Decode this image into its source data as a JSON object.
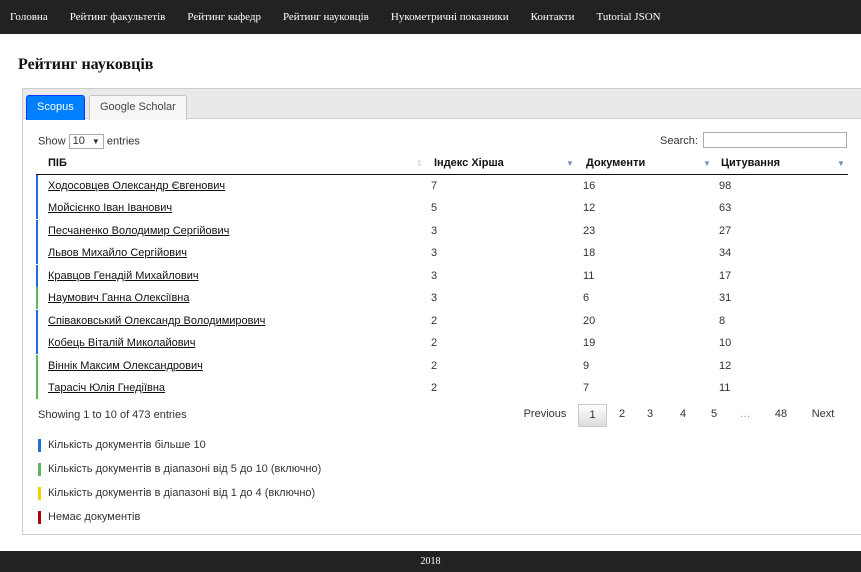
{
  "nav": [
    "Головна",
    "Рейтинг факультетів",
    "Рейтинг кафедр",
    "Рейтинг науковців",
    "Нукометричні показники",
    "Контакти",
    "Tutorial JSON"
  ],
  "page_title": "Рейтинг науковців",
  "tabs": [
    {
      "label": "Scopus",
      "active": true
    },
    {
      "label": "Google Scholar",
      "active": false
    }
  ],
  "table_controls": {
    "show_label": "Show",
    "entries_value": "10",
    "entries_label": "entries",
    "search_label": "Search:",
    "search_value": ""
  },
  "columns": [
    "ПІБ",
    "Індекс Хірша",
    "Документи",
    "Цитування"
  ],
  "colors": {
    "more_than_10": "#1f6fd6",
    "range_5_10": "#5cb85c",
    "range_1_4": "#f0d000",
    "none": "#b0000e",
    "active_tab": "#007fff",
    "navbar": "#222222"
  },
  "rows": [
    {
      "name": "Ходосовцев Олександр Євгенович",
      "h_index": "7",
      "documents": "16",
      "citations": "98",
      "category": "more_than_10"
    },
    {
      "name": "Мойсієнко Іван Іванович",
      "h_index": "5",
      "documents": "12",
      "citations": "63",
      "category": "more_than_10"
    },
    {
      "name": "Песчаненко Володимир Сергійович",
      "h_index": "3",
      "documents": "23",
      "citations": "27",
      "category": "more_than_10"
    },
    {
      "name": "Львов Михайло Сергійович",
      "h_index": "3",
      "documents": "18",
      "citations": "34",
      "category": "more_than_10"
    },
    {
      "name": "Кравцов Генадій Михайлович",
      "h_index": "3",
      "documents": "11",
      "citations": "17",
      "category": "more_than_10"
    },
    {
      "name": "Наумович Ганна Олексіївна",
      "h_index": "3",
      "documents": "6",
      "citations": "31",
      "category": "range_5_10"
    },
    {
      "name": "Співаковський Олександр Володимирович",
      "h_index": "2",
      "documents": "20",
      "citations": "8",
      "category": "more_than_10"
    },
    {
      "name": "Кобець Віталій Миколайович",
      "h_index": "2",
      "documents": "19",
      "citations": "10",
      "category": "more_than_10"
    },
    {
      "name": "Віннік Максим Олександрович",
      "h_index": "2",
      "documents": "9",
      "citations": "12",
      "category": "range_5_10"
    },
    {
      "name": "Тарасіч Юлія Гнедіївна",
      "h_index": "2",
      "documents": "7",
      "citations": "11",
      "category": "range_5_10"
    }
  ],
  "info": "Showing 1 to 10 of 473 entries",
  "pagination": {
    "previous": "Previous",
    "pages": [
      "1",
      "2",
      "3",
      "4",
      "5"
    ],
    "ellipsis": "…",
    "last_page": "48",
    "next": "Next",
    "current": "1"
  },
  "legend": [
    {
      "label": "Кількість документів більше 10",
      "category": "more_than_10"
    },
    {
      "label": "Кількість документів в діапазоні від 5 до 10 (включно)",
      "category": "range_5_10"
    },
    {
      "label": "Кількість документів в діапазоні від 1 до 4 (включно)",
      "category": "range_1_4"
    },
    {
      "label": "Немає документів",
      "category": "none"
    }
  ],
  "footer": "2018"
}
